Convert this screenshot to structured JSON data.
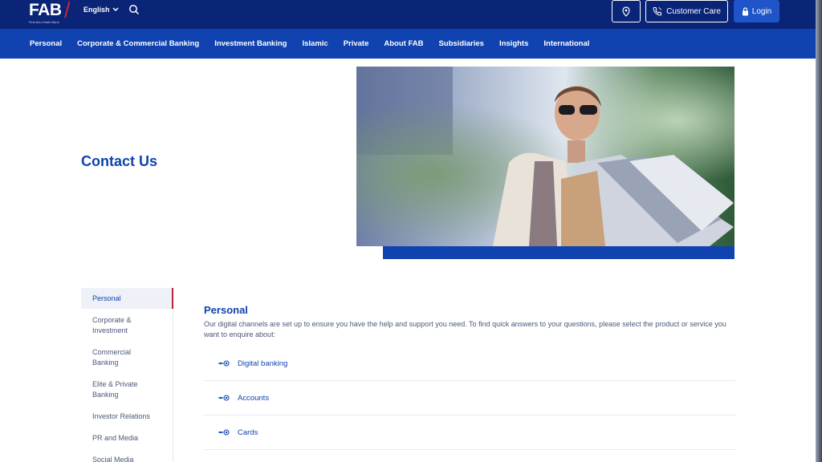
{
  "header": {
    "logo_text": "FAB",
    "logo_sub": "First Abu Dhabi Bank",
    "language": "English",
    "customer_care": "Customer Care",
    "login": "Login"
  },
  "nav": {
    "items": [
      "Personal",
      "Corporate & Commercial Banking",
      "Investment Banking",
      "Islamic",
      "Private",
      "About FAB",
      "Subsidiaries",
      "Insights",
      "International"
    ]
  },
  "hero": {
    "title": "Contact Us"
  },
  "sidebar": {
    "items": [
      "Personal",
      "Corporate & Investment",
      "Commercial Banking",
      "Elite & Private Banking",
      "Investor Relations",
      "PR and Media",
      "Social Media"
    ]
  },
  "main": {
    "title": "Personal",
    "description": "Our digital channels are set up to ensure you have the help and support you need. To find quick answers to your questions, please select the product or service you want to enquire about:",
    "rows": [
      "Digital banking",
      "Accounts",
      "Cards"
    ]
  },
  "colors": {
    "topbar": "#0a2477",
    "nav": "#1043b0",
    "accent": "#1043b0",
    "active_marker": "#b0243c"
  }
}
